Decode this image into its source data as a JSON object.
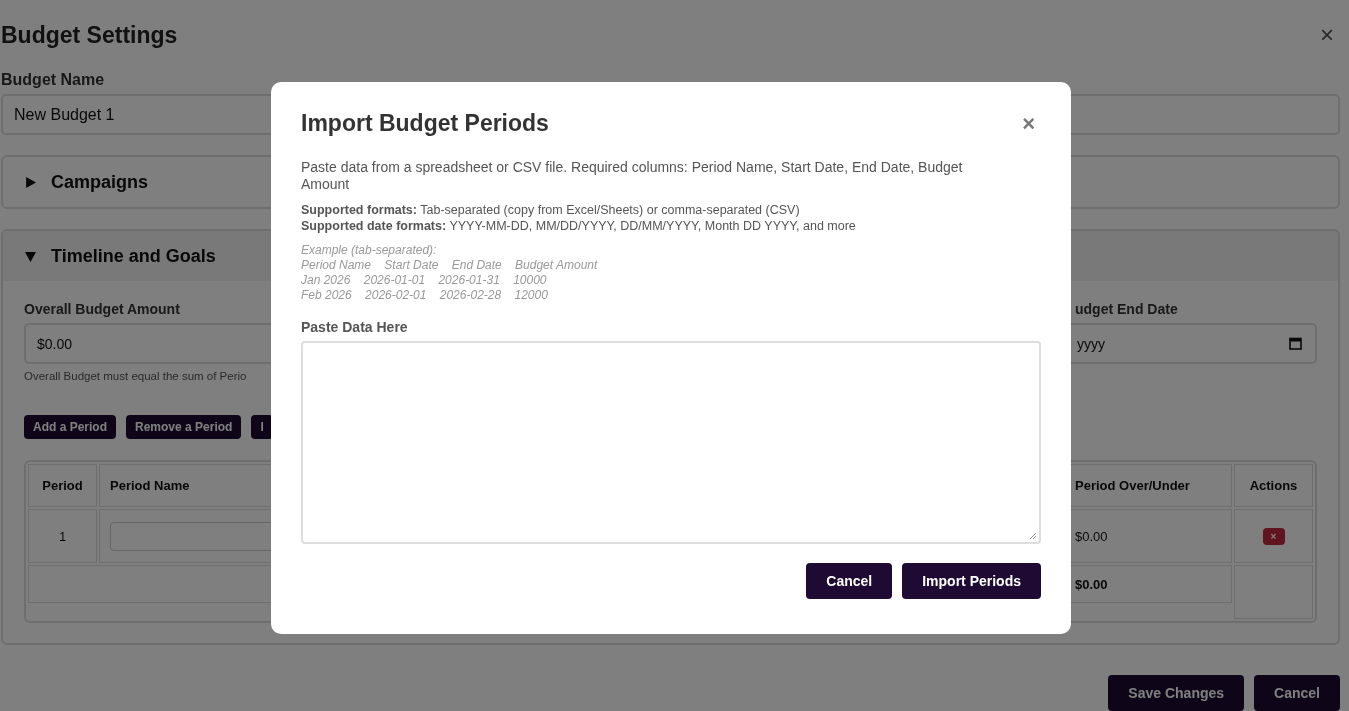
{
  "page": {
    "title": "Budget Settings",
    "close": "×"
  },
  "budget_name": {
    "label": "Budget Name",
    "value": "New Budget 1"
  },
  "sections": [
    {
      "title": "Campaigns",
      "expanded": false
    },
    {
      "title": "Timeline and Goals",
      "expanded": true
    }
  ],
  "timeline": {
    "overall": {
      "label": "Overall Budget Amount",
      "value": "$0.00",
      "note": "Overall Budget must equal the sum of Perio"
    },
    "end_date": {
      "label": "udget End Date",
      "value": "yyyy"
    },
    "buttons": [
      "Add a Period",
      "Remove a Period",
      "I"
    ],
    "table": {
      "columns": [
        "Period",
        "Period Name",
        "Period Over/Under",
        "Actions"
      ],
      "rows": [
        {
          "period": "1",
          "over_under": "$0.00",
          "delete": "×"
        }
      ],
      "total": "$0.00"
    }
  },
  "footer_buttons": [
    "Save Changes",
    "Cancel"
  ],
  "dialog": {
    "title": "Import Budget Periods",
    "close": "×",
    "description": "Paste data from a spreadsheet or CSV file. Required columns: Period Name, Start Date, End Date, Budget Amount",
    "formats": [
      "**Supported formats:** Tab-separated (copy from Excel/Sheets) or comma-separated (CSV)",
      "**Supported date formats:** YYYY-MM-DD, MM/DD/YYYY, DD/MM/YYYY, Month DD YYYY, and more"
    ],
    "example": [
      "Example (tab-separated):",
      "Period Name    Start Date    End Date    Budget Amount",
      "Jan 2026    2026-01-01    2026-01-31    10000",
      "Feb 2026    2026-02-01    2026-02-28    12000"
    ],
    "paste_label": "Paste Data Here",
    "buttons": [
      "Cancel",
      "Import Periods"
    ]
  }
}
